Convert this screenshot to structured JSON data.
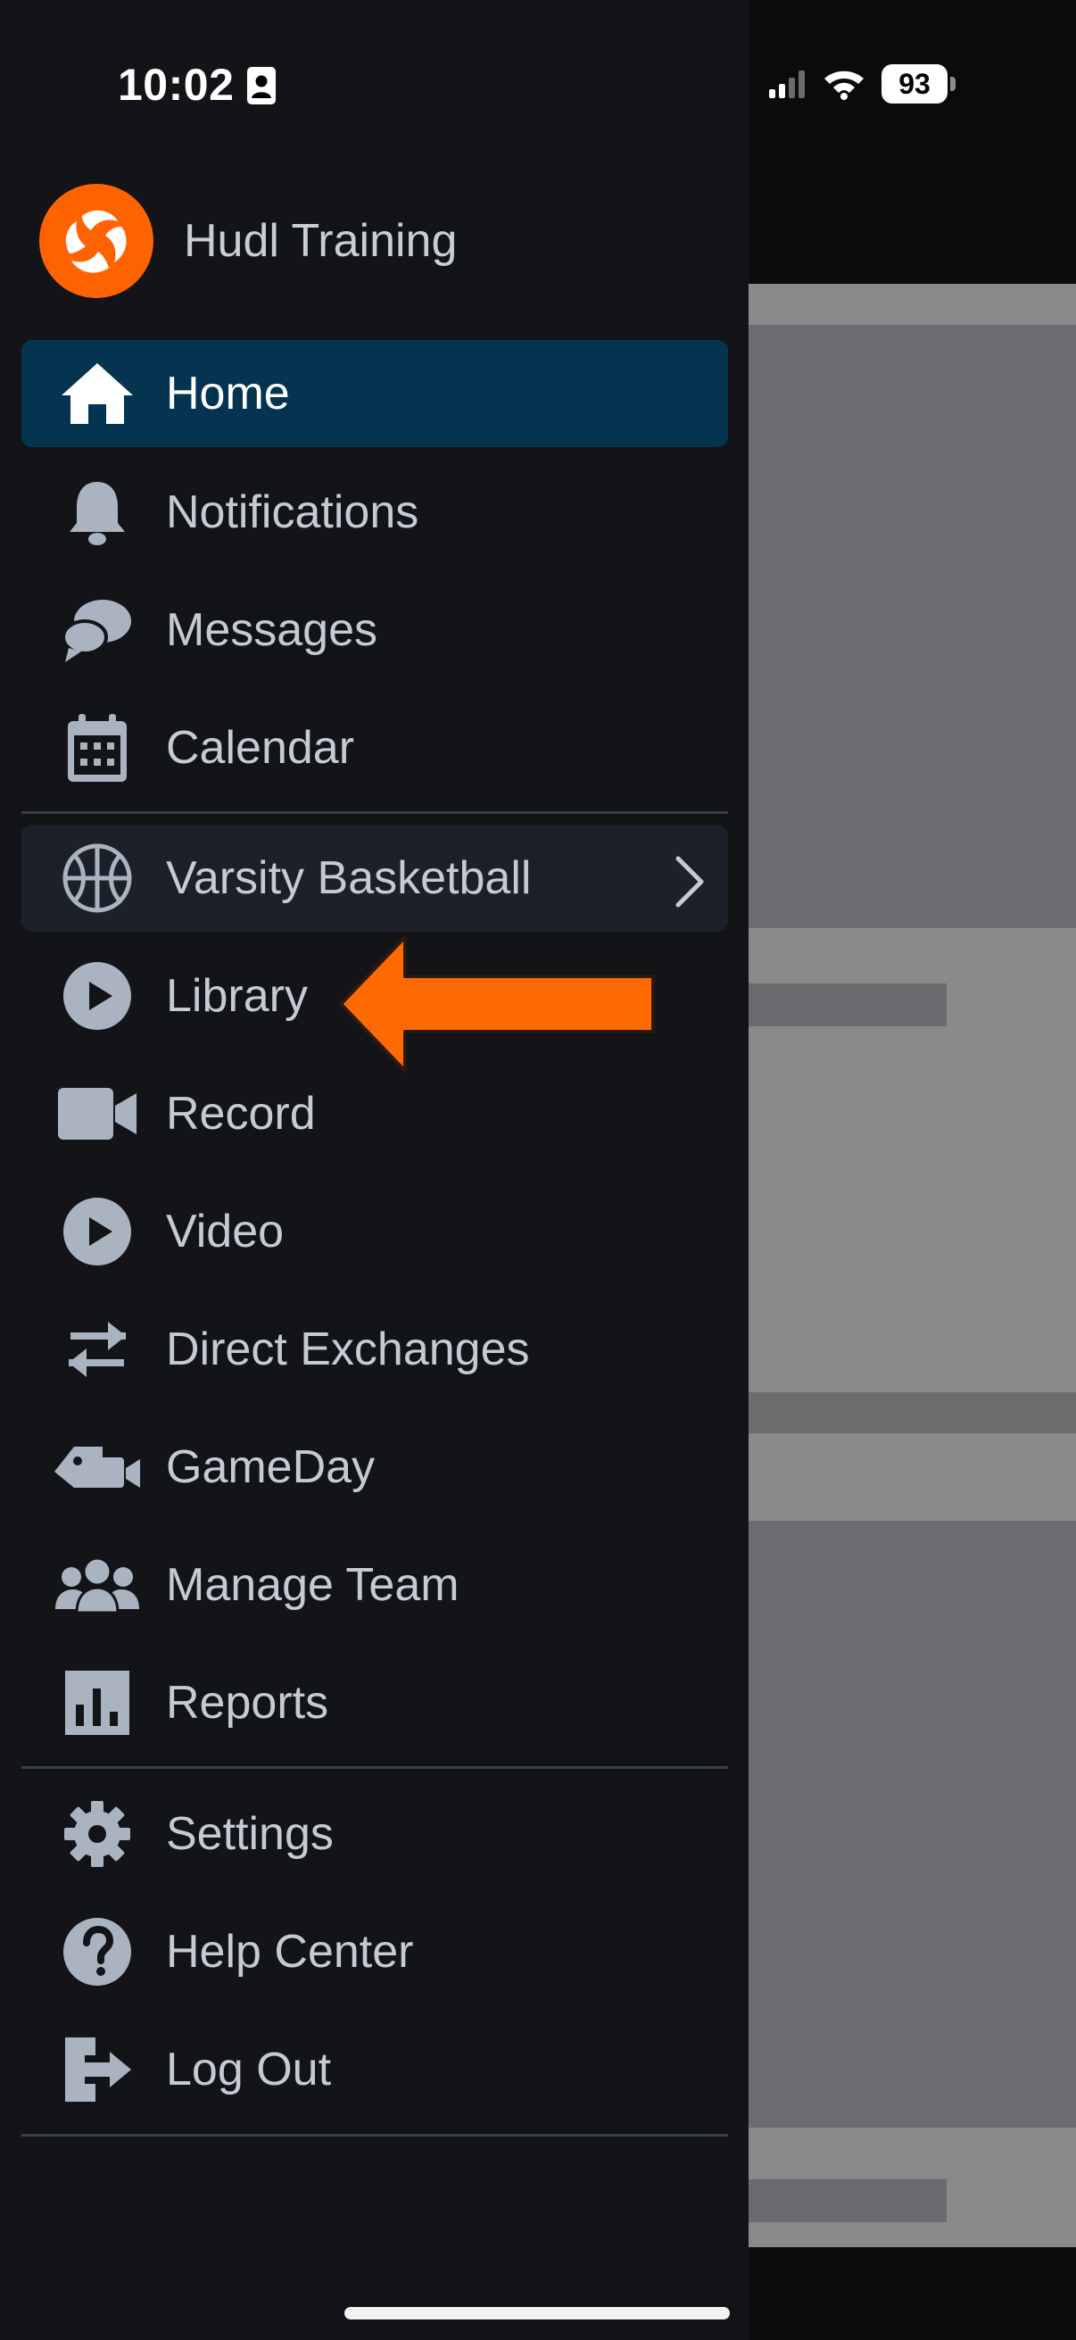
{
  "status_bar": {
    "time": "10:02",
    "battery": "93"
  },
  "drawer": {
    "team_name": "Hudl Training",
    "nav": [
      {
        "id": "home",
        "label": "Home",
        "icon": "home-icon",
        "active": true
      },
      {
        "id": "notifications",
        "label": "Notifications",
        "icon": "bell-icon"
      },
      {
        "id": "messages",
        "label": "Messages",
        "icon": "chat-bubbles-icon"
      },
      {
        "id": "calendar",
        "label": "Calendar",
        "icon": "calendar-icon"
      }
    ],
    "team_selector": {
      "label": "Varsity Basketball",
      "icon": "basketball-icon"
    },
    "team_nav": [
      {
        "id": "library",
        "label": "Library",
        "icon": "play-circle-icon"
      },
      {
        "id": "record",
        "label": "Record",
        "icon": "video-camera-icon"
      },
      {
        "id": "video",
        "label": "Video",
        "icon": "play-circle-icon"
      },
      {
        "id": "direct-exchanges",
        "label": "Direct Exchanges",
        "icon": "swap-arrows-icon"
      },
      {
        "id": "gameday",
        "label": "GameDay",
        "icon": "gameday-ticket-camera-icon"
      },
      {
        "id": "manage-team",
        "label": "Manage Team",
        "icon": "team-group-icon"
      },
      {
        "id": "reports",
        "label": "Reports",
        "icon": "bar-chart-icon"
      }
    ],
    "footer_nav": [
      {
        "id": "settings",
        "label": "Settings",
        "icon": "gear-icon"
      },
      {
        "id": "help-center",
        "label": "Help Center",
        "icon": "question-circle-icon"
      },
      {
        "id": "log-out",
        "label": "Log Out",
        "icon": "log-out-icon"
      }
    ]
  },
  "annotation": {
    "arrow_color": "#ff6a00",
    "points_to": "library"
  },
  "colors": {
    "drawer_bg": "#121417",
    "active_bg": "#053450",
    "text": "#c4cbd4",
    "brand": "#ff6300"
  }
}
